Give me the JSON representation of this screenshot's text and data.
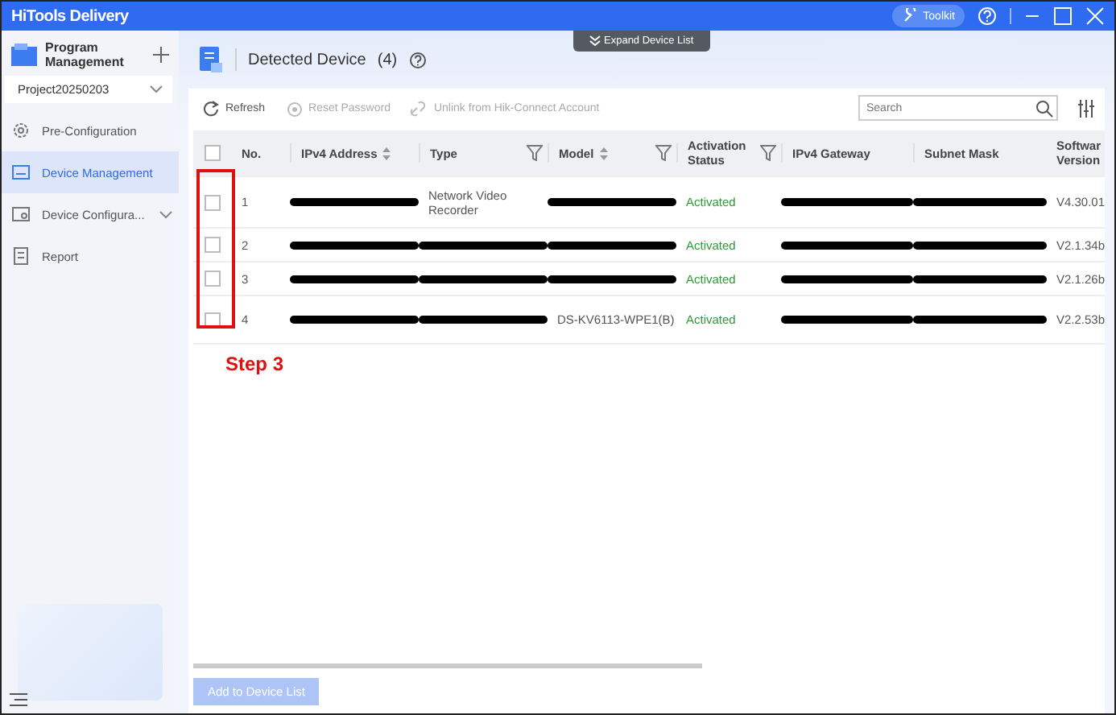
{
  "window": {
    "title": "HiTools Delivery",
    "toolkit": "Toolkit"
  },
  "sidebar": {
    "title": "Program Management",
    "project": "Project20250203",
    "items": [
      {
        "label": "Pre-Configuration",
        "selected": false,
        "expandable": false
      },
      {
        "label": "Device Management",
        "selected": true,
        "expandable": false
      },
      {
        "label": "Device Configura...",
        "selected": false,
        "expandable": true
      },
      {
        "label": "Report",
        "selected": false,
        "expandable": false
      }
    ]
  },
  "expand_tab": "Expand Device List",
  "header": {
    "title": "Detected Device",
    "count": "(4)"
  },
  "toolbar": {
    "actions": [
      {
        "label": "Refresh",
        "disabled": false
      },
      {
        "label": "Reset Password",
        "disabled": true
      },
      {
        "label": "Unlink from Hik-Connect Account",
        "disabled": true
      }
    ],
    "search": {
      "placeholder": "Search"
    }
  },
  "table": {
    "select_all": {
      "checked": false
    },
    "columns": [
      {
        "label": "No.",
        "sortable": false,
        "filterable": false
      },
      {
        "label": "IPv4 Address",
        "sortable": true,
        "filterable": false
      },
      {
        "label": "Type",
        "sortable": false,
        "filterable": true
      },
      {
        "label": "Model",
        "sortable": true,
        "filterable": true
      },
      {
        "label": "Activation Status",
        "sortable": false,
        "filterable": true
      },
      {
        "label": "IPv4 Gateway",
        "sortable": false,
        "filterable": false
      },
      {
        "label": "Subnet Mask",
        "sortable": false,
        "filterable": false
      },
      {
        "label": "Softwar Version"
      }
    ],
    "rows": [
      {
        "no": "1",
        "checked": false,
        "type": "Network Video Recorder",
        "status": "Activated",
        "version": "V4.30.01"
      },
      {
        "no": "2",
        "checked": false,
        "status": "Activated",
        "version": "V2.1.34b"
      },
      {
        "no": "3",
        "checked": false,
        "status": "Activated",
        "version": "V2.1.26b"
      },
      {
        "no": "4",
        "checked": false,
        "model": "DS-KV6113-WPE1(B)",
        "status": "Activated",
        "version": "V2.2.53b"
      }
    ]
  },
  "annotation": {
    "label": "Step 3"
  },
  "footer": {
    "button": "Add to Device List",
    "disabled": true
  }
}
